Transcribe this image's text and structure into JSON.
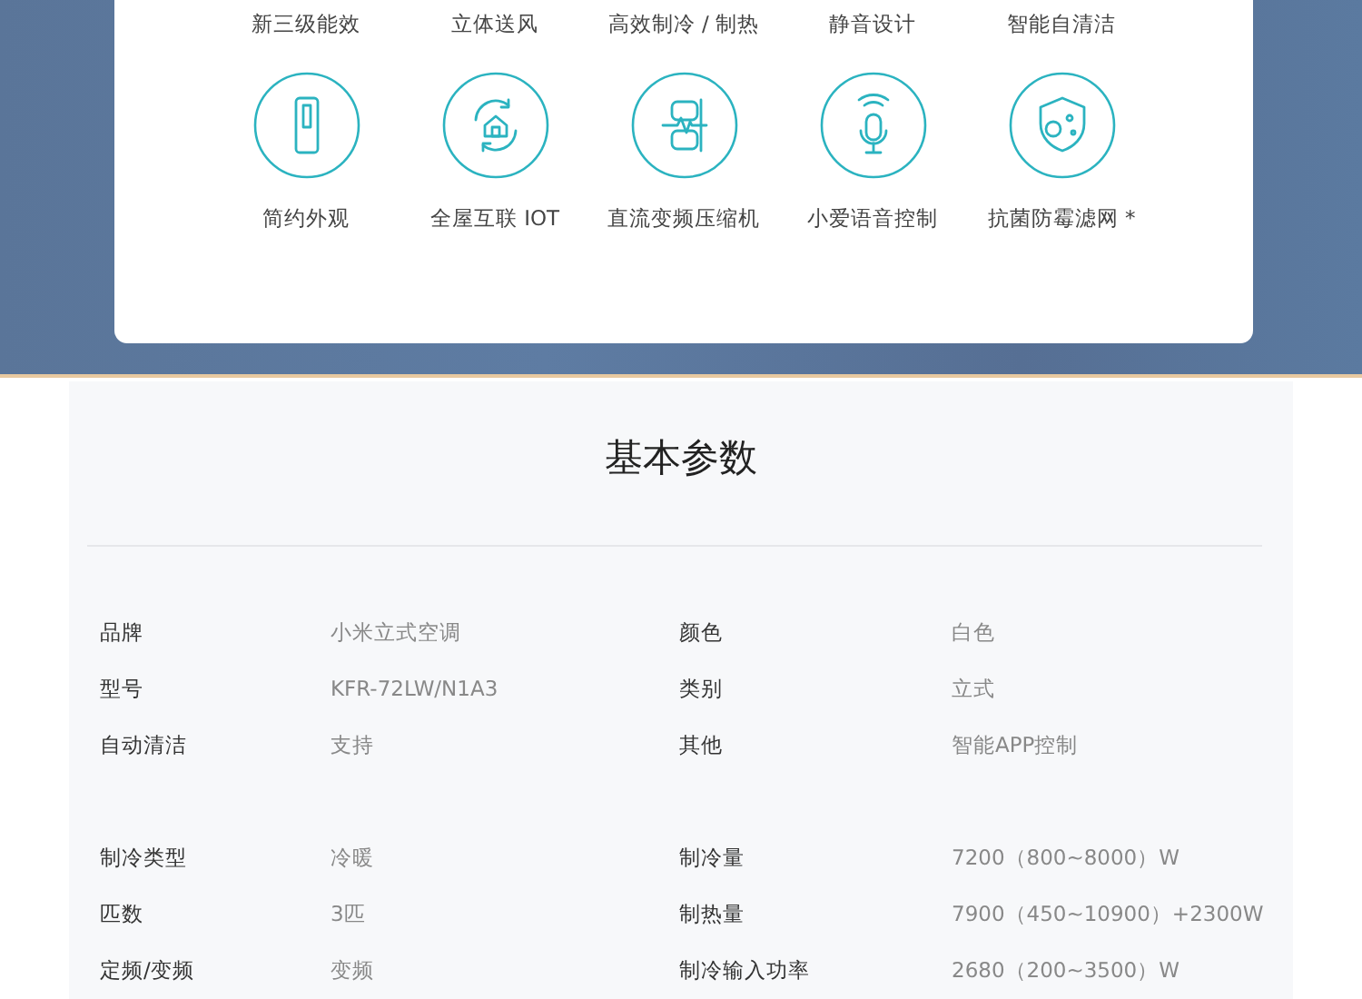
{
  "feature_labels_top": [
    "新三级能效",
    "立体送风",
    "高效制冷 / 制热",
    "静音设计",
    "智能自清洁"
  ],
  "features": [
    {
      "label": "简约外观"
    },
    {
      "label": "全屋互联 IOT"
    },
    {
      "label": "直流变频压缩机"
    },
    {
      "label": "小爱语音控制"
    },
    {
      "label": "抗菌防霉滤网 *"
    }
  ],
  "specs": {
    "title": "基本参数",
    "groups": [
      [
        {
          "name": "品牌",
          "value": "小米立式空调",
          "name_2": "颜色",
          "value_2": "白色"
        },
        {
          "name": "型号",
          "value": "KFR-72LW/N1A3",
          "name_2": "类别",
          "value_2": "立式"
        },
        {
          "name": "自动清洁",
          "value": "支持",
          "name_2": "其他",
          "value_2": "智能APP控制"
        }
      ],
      [
        {
          "name": "制冷类型",
          "value": "冷暖",
          "name_2": "制冷量",
          "value_2": "7200（800~8000）W"
        },
        {
          "name": "匹数",
          "value": "3匹",
          "name_2": "制热量",
          "value_2": "7900（450~10900）+2300W"
        },
        {
          "name": "定频/变频",
          "value": "变频",
          "name_2": "制冷输入功率",
          "value_2": "2680（200~3500）W"
        }
      ]
    ]
  }
}
